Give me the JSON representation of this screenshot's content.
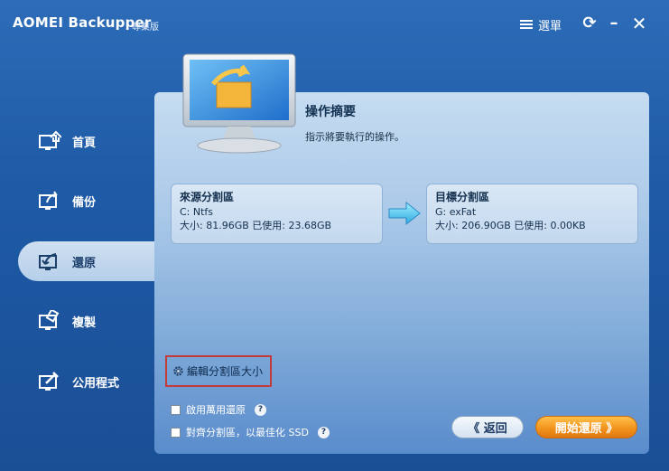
{
  "titlebar": {
    "title": "AOMEI Backupper",
    "edition": "專業版",
    "menu_label": "選單",
    "refresh_glyph": "⟳",
    "minimize_glyph": "–",
    "close_glyph": "✕"
  },
  "sidebar": {
    "items": [
      {
        "label": "首頁",
        "icon": "home-icon",
        "active": false
      },
      {
        "label": "備份",
        "icon": "backup-icon",
        "active": false
      },
      {
        "label": "還原",
        "icon": "restore-icon",
        "active": true
      },
      {
        "label": "複製",
        "icon": "clone-icon",
        "active": false
      },
      {
        "label": "公用程式",
        "icon": "utilities-icon",
        "active": false
      }
    ]
  },
  "summary": {
    "title": "操作摘要",
    "description": "指示將要執行的操作。"
  },
  "source": {
    "title": "來源分割區",
    "filesystem": "C: Ntfs",
    "size": "大小: 81.96GB  已使用: 23.68GB"
  },
  "target": {
    "title": "目標分割區",
    "filesystem": "G: exFat",
    "size": "大小: 206.90GB  已使用: 0.00KB"
  },
  "edit_resize_label": "編輯分割區大小",
  "options": {
    "universal_restore": "啟用萬用還原",
    "align_ssd": "對齊分割區，以最佳化 SSD",
    "help_glyph": "?"
  },
  "buttons": {
    "back": "《 返回",
    "start": "開始還原 》"
  },
  "colors": {
    "accent_orange": "#f0901a",
    "highlight_red": "#c23a3a",
    "window_blue": "#1e5aa6"
  }
}
